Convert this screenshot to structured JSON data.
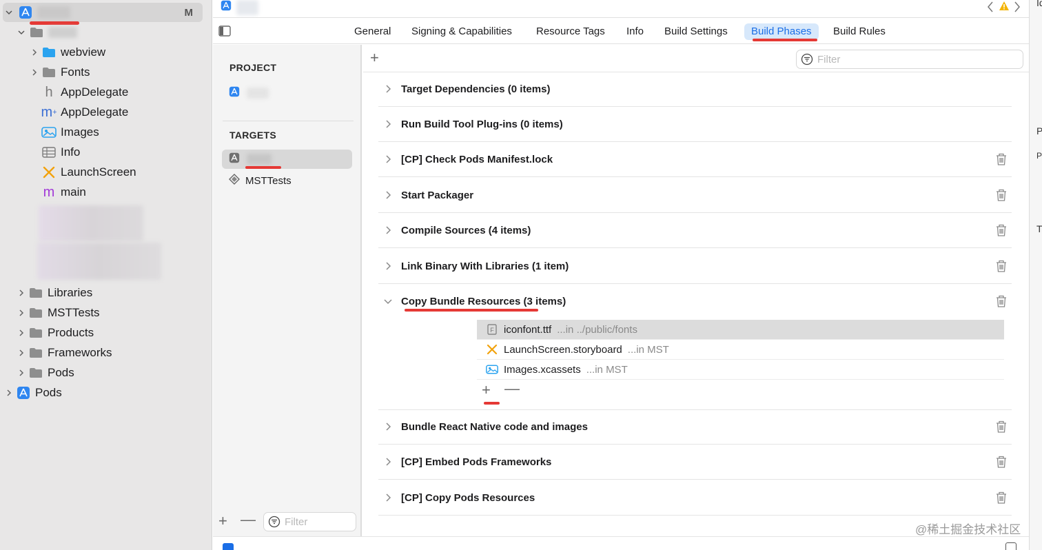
{
  "navigator": {
    "root_badge": "M",
    "items": [
      {
        "label": "webview"
      },
      {
        "label": "Fonts"
      },
      {
        "label": "AppDelegate",
        "prefix": "h"
      },
      {
        "label": "AppDelegate",
        "prefix": "m"
      },
      {
        "label": "Images"
      },
      {
        "label": "Info"
      },
      {
        "label": "LaunchScreen"
      },
      {
        "label": "main",
        "prefix": "m"
      },
      {
        "label": "Libraries"
      },
      {
        "label": "MSTTests"
      },
      {
        "label": "Products"
      },
      {
        "label": "Frameworks"
      },
      {
        "label": "Pods"
      },
      {
        "label": "Pods"
      }
    ]
  },
  "tabs": [
    {
      "label": "General"
    },
    {
      "label": "Signing & Capabilities"
    },
    {
      "label": "Resource Tags"
    },
    {
      "label": "Info"
    },
    {
      "label": "Build Settings"
    },
    {
      "label": "Build Phases",
      "active": true
    },
    {
      "label": "Build Rules"
    }
  ],
  "project_column": {
    "project_header": "PROJECT",
    "targets_header": "TARGETS",
    "tests_target": "MSTTests",
    "filter_placeholder": "Filter"
  },
  "main": {
    "filter_placeholder": "Filter",
    "phases": [
      {
        "title": "Target Dependencies (0 items)"
      },
      {
        "title": "Run Build Tool Plug-ins (0 items)"
      },
      {
        "title": "[CP] Check Pods Manifest.lock"
      },
      {
        "title": "Start Packager"
      },
      {
        "title": "Compile Sources (4 items)"
      },
      {
        "title": "Link Binary With Libraries (1 item)"
      },
      {
        "title": "Copy Bundle Resources (3 items)"
      },
      {
        "title": "Bundle React Native code and images"
      },
      {
        "title": "[CP] Embed Pods Frameworks"
      },
      {
        "title": "[CP] Copy Pods Resources"
      }
    ],
    "resources": [
      {
        "name": "iconfont.ttf",
        "location": "...in ../public/fonts"
      },
      {
        "name": "LaunchScreen.storyboard",
        "location": "...in MST"
      },
      {
        "name": "Images.xcassets",
        "location": "...in MST"
      }
    ]
  },
  "inspector": {
    "letters": [
      "Id",
      "P",
      "P",
      "T"
    ]
  },
  "watermark": "@稀土掘金技术社区",
  "colors": {
    "accent": "#1a6ee6",
    "annotation_red": "#e53935",
    "nav_bg": "#e8e7e7"
  }
}
